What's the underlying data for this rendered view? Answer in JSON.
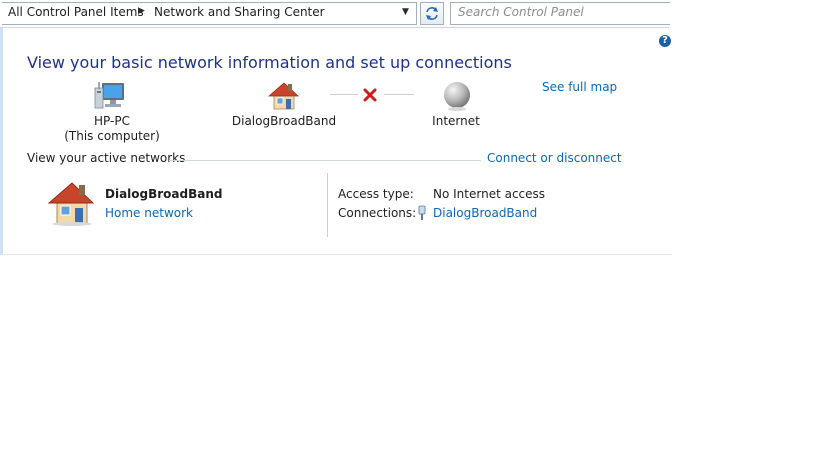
{
  "address_bar": {
    "breadcrumbs": [
      "All Control Panel Items",
      "Network and Sharing Center"
    ],
    "search_placeholder": "Search Control Panel"
  },
  "main": {
    "title": "View your basic network information and set up connections",
    "see_full_map": "See full map",
    "map": {
      "computer": {
        "name": "HP-PC",
        "sub": "(This computer)",
        "icon": "computer-icon"
      },
      "network": {
        "name": "DialogBroadBand",
        "icon": "house-icon"
      },
      "internet": {
        "name": "Internet",
        "icon": "globe-icon"
      },
      "connection_status_icon": "red-x-icon"
    },
    "active_networks": {
      "heading": "View your active networks",
      "connect_link": "Connect or disconnect",
      "items": [
        {
          "name": "DialogBroadBand",
          "type": "Home network",
          "access_type_label": "Access type:",
          "access_type": "No Internet access",
          "connections_label": "Connections:",
          "connection": "DialogBroadBand"
        }
      ]
    }
  },
  "colors": {
    "title": "#1e3287",
    "link": "#0f66b0",
    "error_x": "#d11a1a"
  }
}
